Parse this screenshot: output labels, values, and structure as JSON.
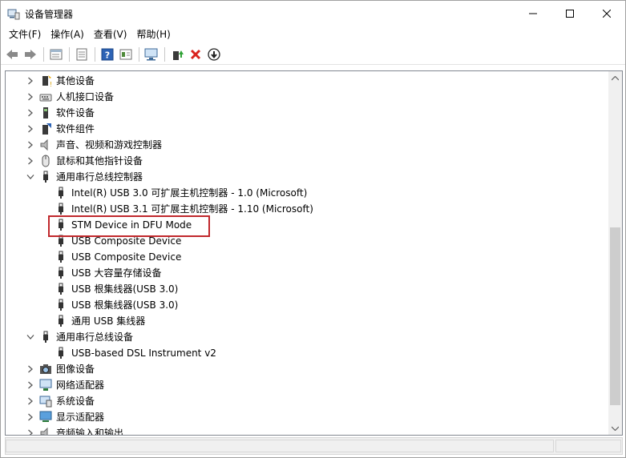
{
  "window": {
    "title": "设备管理器"
  },
  "menu": [
    "文件(F)",
    "操作(A)",
    "查看(V)",
    "帮助(H)"
  ],
  "toolbar": [
    "back-icon",
    "forward-icon",
    "properties-icon",
    "refresh-list-icon",
    "help-icon",
    "view-details-icon",
    "scan-hardware-icon",
    "update-driver-icon",
    "uninstall-icon",
    "disable-icon"
  ],
  "tree": {
    "rows": [
      {
        "label": "其他设备",
        "level": 0,
        "state": "collapsed",
        "icon": "unknown-device-icon"
      },
      {
        "label": "人机接口设备",
        "level": 0,
        "state": "collapsed",
        "icon": "hid-icon"
      },
      {
        "label": "软件设备",
        "level": 0,
        "state": "collapsed",
        "icon": "software-device-icon"
      },
      {
        "label": "软件组件",
        "level": 0,
        "state": "collapsed",
        "icon": "software-component-icon"
      },
      {
        "label": "声音、视频和游戏控制器",
        "level": 0,
        "state": "collapsed",
        "icon": "speaker-icon"
      },
      {
        "label": "鼠标和其他指针设备",
        "level": 0,
        "state": "collapsed",
        "icon": "mouse-icon"
      },
      {
        "label": "通用串行总线控制器",
        "level": 0,
        "state": "expanded",
        "icon": "usb-icon"
      },
      {
        "label": "Intel(R) USB 3.0 可扩展主机控制器 - 1.0 (Microsoft)",
        "level": 1,
        "state": "leaf",
        "icon": "usb-icon"
      },
      {
        "label": "Intel(R) USB 3.1 可扩展主机控制器 - 1.10 (Microsoft)",
        "level": 1,
        "state": "leaf",
        "icon": "usb-icon"
      },
      {
        "label": "STM Device in DFU Mode",
        "level": 1,
        "state": "leaf",
        "icon": "usb-icon",
        "highlighted": true
      },
      {
        "label": "USB Composite Device",
        "level": 1,
        "state": "leaf",
        "icon": "usb-icon"
      },
      {
        "label": "USB Composite Device",
        "level": 1,
        "state": "leaf",
        "icon": "usb-icon"
      },
      {
        "label": "USB 大容量存储设备",
        "level": 1,
        "state": "leaf",
        "icon": "usb-icon"
      },
      {
        "label": "USB 根集线器(USB 3.0)",
        "level": 1,
        "state": "leaf",
        "icon": "usb-icon"
      },
      {
        "label": "USB 根集线器(USB 3.0)",
        "level": 1,
        "state": "leaf",
        "icon": "usb-icon"
      },
      {
        "label": "通用 USB 集线器",
        "level": 1,
        "state": "leaf",
        "icon": "usb-icon"
      },
      {
        "label": "通用串行总线设备",
        "level": 0,
        "state": "expanded",
        "icon": "usb-icon"
      },
      {
        "label": "USB-based DSL Instrument v2",
        "level": 1,
        "state": "leaf",
        "icon": "usb-icon"
      },
      {
        "label": "图像设备",
        "level": 0,
        "state": "collapsed",
        "icon": "camera-icon"
      },
      {
        "label": "网络适配器",
        "level": 0,
        "state": "collapsed",
        "icon": "network-adapter-icon"
      },
      {
        "label": "系统设备",
        "level": 0,
        "state": "collapsed",
        "icon": "system-device-icon"
      },
      {
        "label": "显示适配器",
        "level": 0,
        "state": "collapsed",
        "icon": "display-adapter-icon"
      },
      {
        "label": "音频输入和输出",
        "level": 0,
        "state": "collapsed",
        "icon": "audio-io-icon"
      }
    ]
  },
  "colors": {
    "highlight_border": "#c0282c",
    "scroll_thumb": "#cdcdcd"
  }
}
